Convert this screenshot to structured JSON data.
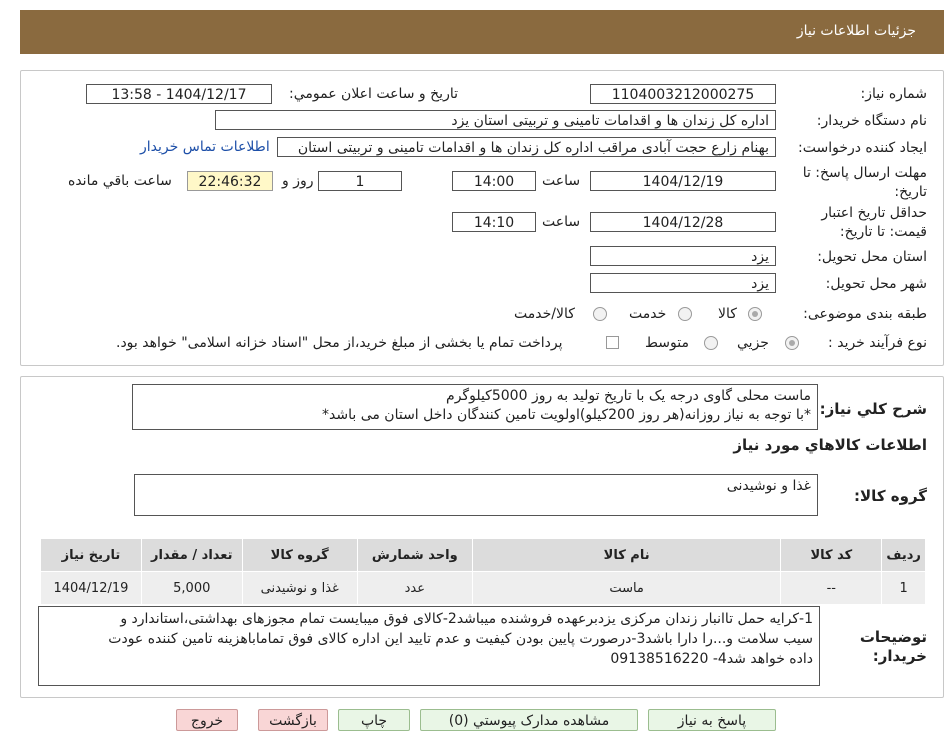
{
  "header": {
    "title": "جزئیات اطلاعات نیاز"
  },
  "fields": {
    "need_number_label": "شماره نیاز:",
    "need_number": "1104003212000275",
    "announce_label": "تاریخ و ساعت اعلان عمومي:",
    "announce_value": "1404/12/17 - 13:58",
    "buyer_label": "نام دستگاه خريدار:",
    "buyer_value": "اداره کل زندان ها و اقدامات تامینی و تربیتی استان یزد",
    "creator_label": "ايجاد کننده درخواست:",
    "creator_value": "بهنام زارع حجت آبادی مراقب اداره کل زندان ها و اقدامات تامینی و تربیتی استان",
    "contact_link": "اطلاعات تماس خريدار",
    "deadline_label_1": "مهلت ارسال پاسخ: تا",
    "deadline_label_2": "تاريخ:",
    "deadline_date": "1404/12/19",
    "time_label": "ساعت",
    "deadline_time": "14:00",
    "days_value": "1",
    "days_label": "روز و",
    "remaining_time": "22:46:32",
    "remaining_label": "ساعت باقي مانده",
    "validity_label_1": "حداقل تاريخ اعتبار",
    "validity_label_2": "قيمت: تا تاريخ:",
    "validity_date": "1404/12/28",
    "validity_time": "14:10",
    "province_label": "استان محل تحويل:",
    "province_value": "یزد",
    "city_label": "شهر محل تحويل:",
    "city_value": "یزد",
    "category_label": "طبقه بندی موضوعی:",
    "category_options": [
      "کالا",
      "خدمت",
      "کالا/خدمت"
    ],
    "process_label": "نوع فرآيند خريد :",
    "process_options": [
      "جزيي",
      "متوسط"
    ],
    "payment_note": "پرداخت تمام يا بخشی از مبلغ خريد،از محل \"اسناد خزانه اسلامی\" خواهد بود."
  },
  "description": {
    "label": "شرح كلي نياز:",
    "line1": "ماست محلی گاوی درجه یک با تاریخ تولید به روز 5000کیلوگرم",
    "line2": "*با توجه به نیاز روزانه(هر روز 200کیلو)اولویت تامین کنندگان داخل استان می باشد*"
  },
  "goods": {
    "section_title": "اطلاعات کالاهاي مورد نياز",
    "group_label": "گروه کالا:",
    "group_value": "غذا و نوشیدنی",
    "columns": [
      "رديف",
      "کد کالا",
      "نام کالا",
      "واحد شمارش",
      "گروه کالا",
      "تعداد / مقدار",
      "تاريخ نياز"
    ],
    "rows": [
      [
        "1",
        "--",
        "ماست",
        "عدد",
        "غذا و نوشیدنی",
        "5,000",
        "1404/12/19"
      ]
    ]
  },
  "buyer_notes": {
    "label_1": "توضيحات",
    "label_2": "خريدار:",
    "line1": "1-کرایه حمل تاانبار زندان مرکزی یزدبرعهده فروشنده میباشد2-کالای فوق میبایست تمام مجوزهای بهداشتی،استاندارد و",
    "line2": "سیب سلامت و...را دارا باشد3-درصورت پایین بودن کیفیت و عدم تایید این اداره کالای فوق تماماباهزینه تامین کننده عودت",
    "line3": "داده خواهد شد4- 09138516220"
  },
  "buttons": {
    "reply": "پاسخ به نياز",
    "attachments": "مشاهده مدارک پيوستي (0)",
    "print": "چاپ",
    "back": "بازگشت",
    "exit": "خروج"
  },
  "colors": {
    "header_bg": "#8a6a3f",
    "link": "#1d4fa8",
    "timer_bg": "#fff8c8"
  }
}
